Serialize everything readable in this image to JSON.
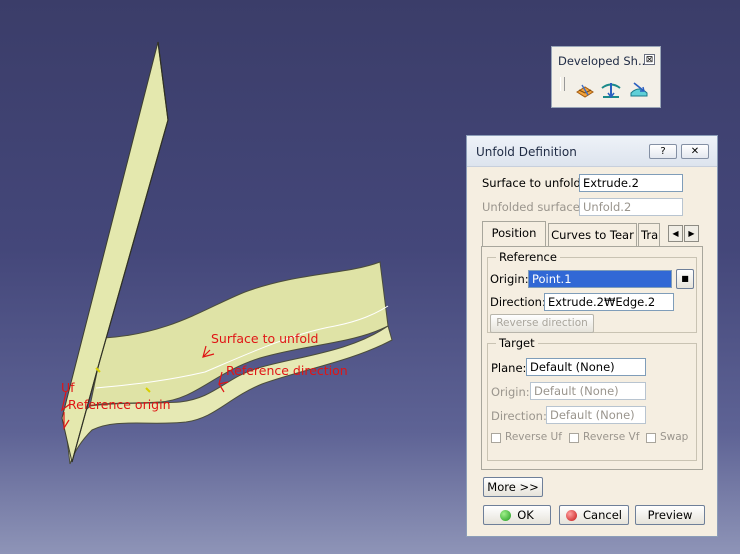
{
  "viewport": {
    "annotations": {
      "surface_to_unfold": "Surface to unfold",
      "reference_direction": "Reference direction",
      "reference_origin": "Reference origin",
      "uv_label": "Uf"
    }
  },
  "toolbar": {
    "title": "Developed Sh...",
    "close_glyph": "⊠",
    "icons": [
      "develop-icon",
      "unfold-icon",
      "transfer-icon"
    ]
  },
  "dialog": {
    "title": "Unfold Definition",
    "help_glyph": "?",
    "close_glyph": "✕",
    "surface_to_unfold": {
      "label": "Surface to unfold:",
      "value": "Extrude.2"
    },
    "unfolded_surface": {
      "label": "Unfolded surface:",
      "value": "Unfold.2"
    },
    "tabs": [
      "Position",
      "Curves to Tear",
      "Tra"
    ],
    "active_tab": "Position",
    "reference": {
      "title": "Reference",
      "origin": {
        "label": "Origin:",
        "value": "Point.1"
      },
      "direction": {
        "label": "Direction:",
        "value": "Extrude.2₩Edge.2"
      },
      "reverse_button": "Reverse direction"
    },
    "target": {
      "title": "Target",
      "plane": {
        "label": "Plane:",
        "value": "Default (None)"
      },
      "origin": {
        "label": "Origin:",
        "value": "Default (None)"
      },
      "direction": {
        "label": "Direction:",
        "value": "Default (None)"
      },
      "checkboxes": [
        "Reverse Uf",
        "Reverse Vf",
        "Swap"
      ]
    },
    "more_button": "More >>",
    "ok_button": "OK",
    "cancel_button": "Cancel",
    "preview_button": "Preview"
  },
  "colors": {
    "surface_fill": "#e8ecb4",
    "annotation": "#e01515",
    "selection": "#3168d5",
    "dialog_bg": "#f5eee1"
  }
}
